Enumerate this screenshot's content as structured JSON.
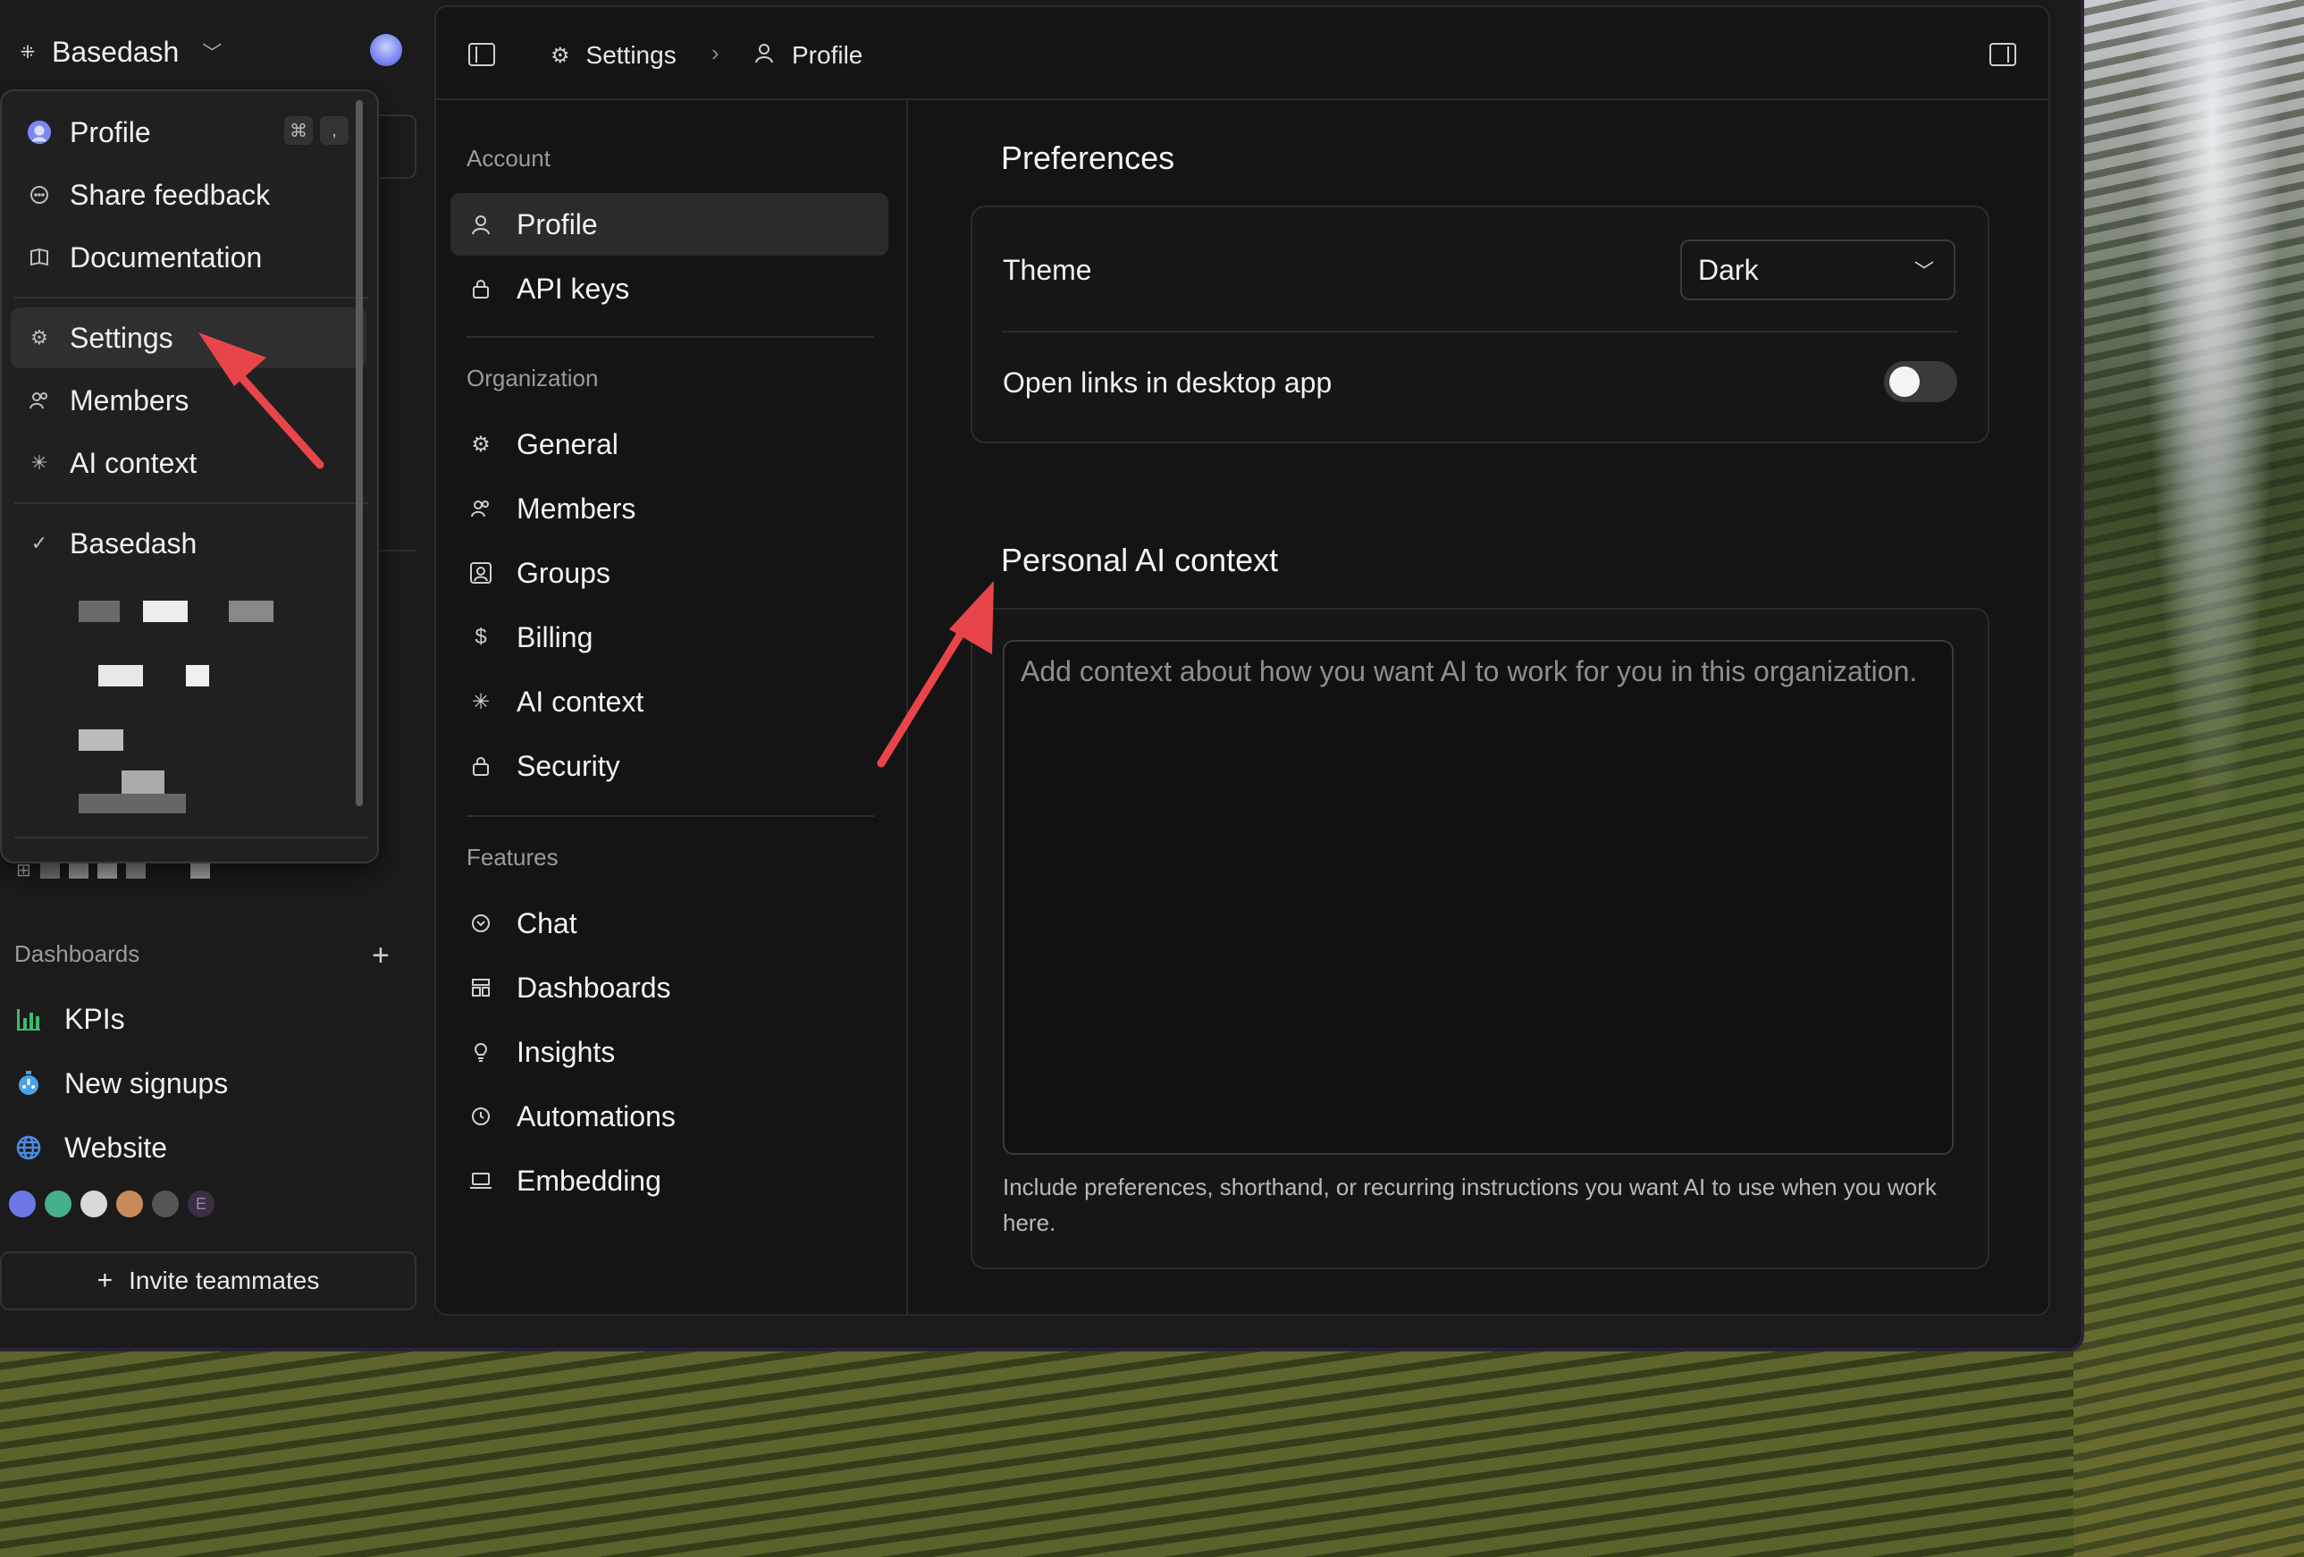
{
  "workspace": {
    "name": "Basedash"
  },
  "menu": {
    "items": [
      {
        "label": "Profile",
        "icon": "profile-avatar-icon",
        "shortcut": [
          "⌘",
          ","
        ]
      },
      {
        "label": "Share feedback",
        "icon": "chat-bubble-icon"
      },
      {
        "label": "Documentation",
        "icon": "book-icon"
      },
      {
        "label": "Settings",
        "icon": "gear-icon"
      },
      {
        "label": "Members",
        "icon": "members-icon"
      },
      {
        "label": "AI context",
        "icon": "asterisk-icon"
      }
    ],
    "workspace_check": {
      "label": "Basedash",
      "icon": "check-icon"
    }
  },
  "sidebar": {
    "dashboards_title": "Dashboards",
    "dashboards": [
      {
        "label": "KPIs",
        "icon": "bar-chart-icon",
        "color": "#3fb96b"
      },
      {
        "label": "New signups",
        "icon": "stopwatch-icon",
        "color": "#4aa3e8"
      },
      {
        "label": "Website",
        "icon": "globe-icon",
        "color": "#4b8be0"
      }
    ],
    "avatar_initial": "E",
    "invite_label": "Invite teammates"
  },
  "breadcrumb": {
    "settings": "Settings",
    "profile": "Profile"
  },
  "settings_nav": {
    "account_title": "Account",
    "account": [
      {
        "label": "Profile",
        "icon": "person-icon"
      },
      {
        "label": "API keys",
        "icon": "lock-icon"
      }
    ],
    "organization_title": "Organization",
    "organization": [
      {
        "label": "General",
        "icon": "gear-icon"
      },
      {
        "label": "Members",
        "icon": "members-icon"
      },
      {
        "label": "Groups",
        "icon": "groups-icon"
      },
      {
        "label": "Billing",
        "icon": "dollar-icon"
      },
      {
        "label": "AI context",
        "icon": "asterisk-icon"
      },
      {
        "label": "Security",
        "icon": "lock-icon"
      }
    ],
    "features_title": "Features",
    "features": [
      {
        "label": "Chat",
        "icon": "chat-icon"
      },
      {
        "label": "Dashboards",
        "icon": "dashboard-icon"
      },
      {
        "label": "Insights",
        "icon": "lightbulb-icon"
      },
      {
        "label": "Automations",
        "icon": "clock-icon"
      },
      {
        "label": "Embedding",
        "icon": "laptop-icon"
      }
    ]
  },
  "preferences": {
    "title": "Preferences",
    "theme_label": "Theme",
    "theme_value": "Dark",
    "links_label": "Open links in desktop app",
    "links_enabled": false
  },
  "ai_context": {
    "title": "Personal AI context",
    "placeholder": "Add context about how you want AI to work for you in this organization.",
    "hint": "Include preferences, shorthand, or recurring instructions you want AI to use when you work here."
  },
  "colors": {
    "accent_arrow": "#e8454b",
    "background": "#1a1a1b"
  }
}
